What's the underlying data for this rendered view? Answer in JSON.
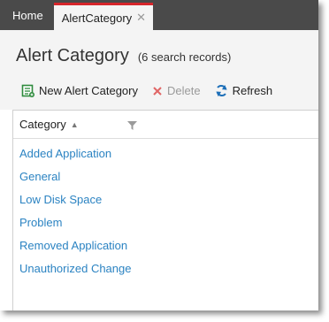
{
  "tabs": [
    {
      "label": "Home",
      "active": false
    },
    {
      "label": "AlertCategory",
      "active": true,
      "close_icon": "close-icon"
    }
  ],
  "page": {
    "title": "Alert Category",
    "record_count": "(6 search records)"
  },
  "toolbar": {
    "new_label": "New Alert Category",
    "delete_label": "Delete",
    "refresh_label": "Refresh"
  },
  "grid": {
    "column_header": "Category",
    "sort": "ascending",
    "rows": [
      "Added Application",
      "General",
      "Low Disk Space",
      "Problem",
      "Removed Application",
      "Unauthorized Change"
    ]
  },
  "colors": {
    "tabbar": "#4a4a4a",
    "active_tab_accent": "#d6262b",
    "link": "#2b83c2",
    "new_icon": "#2e8b3d",
    "delete_icon": "#e06666",
    "refresh_icon": "#1d6fb8"
  }
}
